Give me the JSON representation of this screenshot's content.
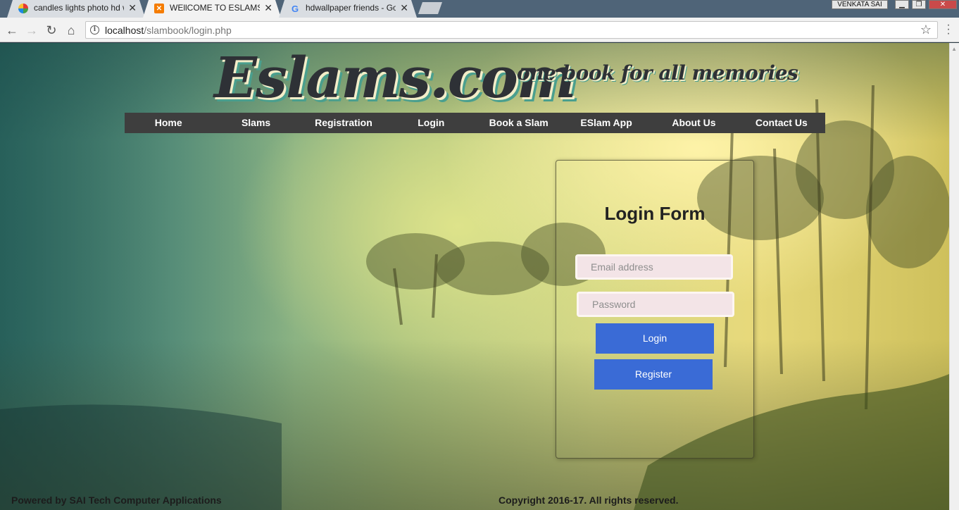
{
  "browser": {
    "tabs": [
      {
        "title": "candles lights photo hd w",
        "favicon": "pinwheel-icon",
        "active": false
      },
      {
        "title": "WEllCOME TO ESLAMS.C",
        "favicon": "xampp-icon",
        "active": true
      },
      {
        "title": "hdwallpaper friends - Go",
        "favicon": "google-icon",
        "active": false
      }
    ],
    "close_glyph": "✕",
    "user_name": "VENKATA SAI",
    "url_host": "localhost",
    "url_path": "/slambook/login.php"
  },
  "site": {
    "logo": "Eslams.com",
    "tagline": "one book for all memories",
    "nav": [
      "Home",
      "Slams",
      "Registration",
      "Login",
      "Book a Slam",
      "ESlam App",
      "About Us",
      "Contact Us"
    ]
  },
  "login_form": {
    "title": "Login Form",
    "email_placeholder": "Email address",
    "password_placeholder": "Password",
    "login_button": "Login",
    "register_button": "Register"
  },
  "footer": {
    "powered_by": "Powered by SAI Tech Computer Applications",
    "copyright": "Copyright 2016-17. All rights reserved."
  },
  "colors": {
    "nav_bg": "#3e3e3e",
    "button_blue": "#3a6bd6",
    "input_bg": "#f3e4e7"
  }
}
